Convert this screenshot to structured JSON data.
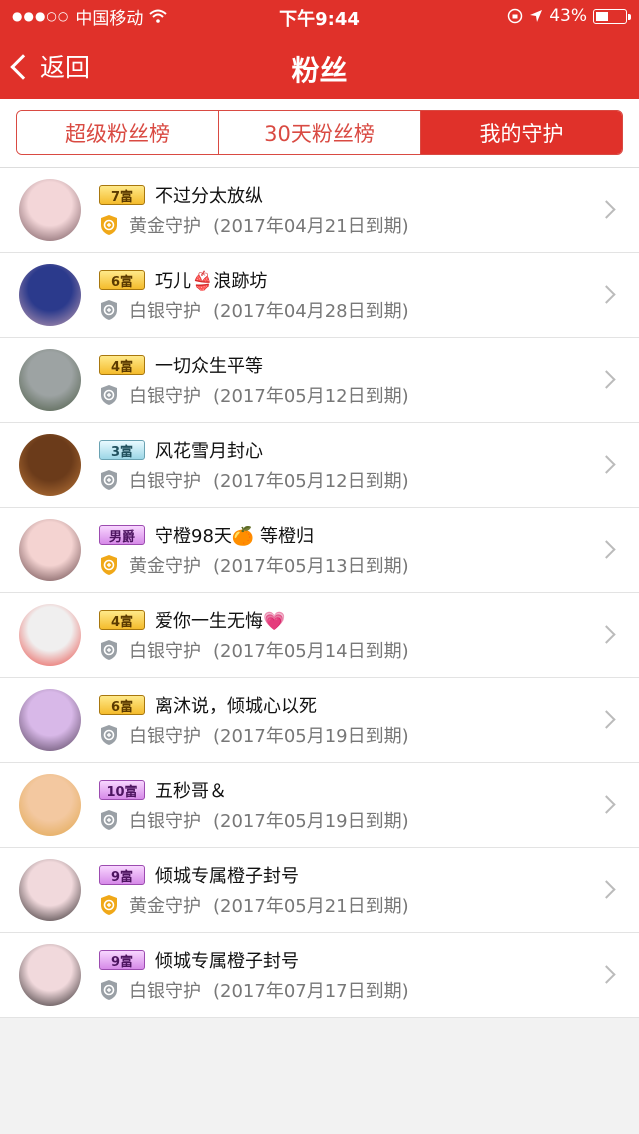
{
  "status": {
    "signal": "●●●○○",
    "carrier": "中国移动",
    "time": "下午9:44",
    "battery": "43%",
    "battery_level": 0.43
  },
  "nav": {
    "back_label": "返回",
    "title": "粉丝"
  },
  "tabs": [
    {
      "label": "超级粉丝榜",
      "active": false
    },
    {
      "label": "30天粉丝榜",
      "active": false
    },
    {
      "label": "我的守护",
      "active": true
    }
  ],
  "fans": [
    {
      "badge": "7富",
      "badge_style": "gold",
      "name": "不过分太放纵",
      "tier": "黄金守护",
      "tier_color": "#f0a818",
      "expire": "(2017年04月21日到期)",
      "avatar_colors": [
        "#f3d6d8",
        "#6a4b52"
      ]
    },
    {
      "badge": "6富",
      "badge_style": "gold",
      "name": "巧儿👙浪跡坊",
      "tier": "白银守护",
      "tier_color": "#9aa0a6",
      "expire": "(2017年04月28日到期)",
      "avatar_colors": [
        "#2b3a8c",
        "#c9a3b6"
      ]
    },
    {
      "badge": "4富",
      "badge_style": "gold",
      "name": "一切众生平等",
      "tier": "白银守护",
      "tier_color": "#9aa0a6",
      "expire": "(2017年05月12日到期)",
      "avatar_colors": [
        "#9da3a3",
        "#46563f"
      ]
    },
    {
      "badge": "3富",
      "badge_style": "silverblue",
      "name": "风花雪月封心",
      "tier": "白银守护",
      "tier_color": "#9aa0a6",
      "expire": "(2017年05月12日到期)",
      "avatar_colors": [
        "#6b3b1a",
        "#c07a3a"
      ]
    },
    {
      "badge": "男爵",
      "badge_style": "purple",
      "name": "守橙98天🍊 等橙归",
      "tier": "黄金守护",
      "tier_color": "#f0a818",
      "expire": "(2017年05月13日到期)",
      "avatar_colors": [
        "#f4d3d1",
        "#5a3a3e"
      ]
    },
    {
      "badge": "4富",
      "badge_style": "gold",
      "name": "爱你一生无悔💗",
      "tier": "白银守护",
      "tier_color": "#9aa0a6",
      "expire": "(2017年05月14日到期)",
      "avatar_colors": [
        "#f0efef",
        "#e8413b"
      ]
    },
    {
      "badge": "6富",
      "badge_style": "gold",
      "name": "离沐说，倾城心以死",
      "tier": "白银守护",
      "tier_color": "#9aa0a6",
      "expire": "(2017年05月19日到期)",
      "avatar_colors": [
        "#d8b8e8",
        "#4a3850"
      ]
    },
    {
      "badge": "10富",
      "badge_style": "purple",
      "name": "五秒哥＆",
      "tier": "白银守护",
      "tier_color": "#9aa0a6",
      "expire": "(2017年05月19日到期)",
      "avatar_colors": [
        "#f3c8a0",
        "#e0a448"
      ]
    },
    {
      "badge": "9富",
      "badge_style": "purple",
      "name": "倾城专属橙子封号",
      "tier": "黄金守护",
      "tier_color": "#f0a818",
      "expire": "(2017年05月21日到期)",
      "avatar_colors": [
        "#f1d9dc",
        "#1f1a1c"
      ]
    },
    {
      "badge": "9富",
      "badge_style": "purple",
      "name": "倾城专属橙子封号",
      "tier": "白银守护",
      "tier_color": "#9aa0a6",
      "expire": "(2017年07月17日到期)",
      "avatar_colors": [
        "#f1d9dc",
        "#1f1a1c"
      ]
    }
  ]
}
